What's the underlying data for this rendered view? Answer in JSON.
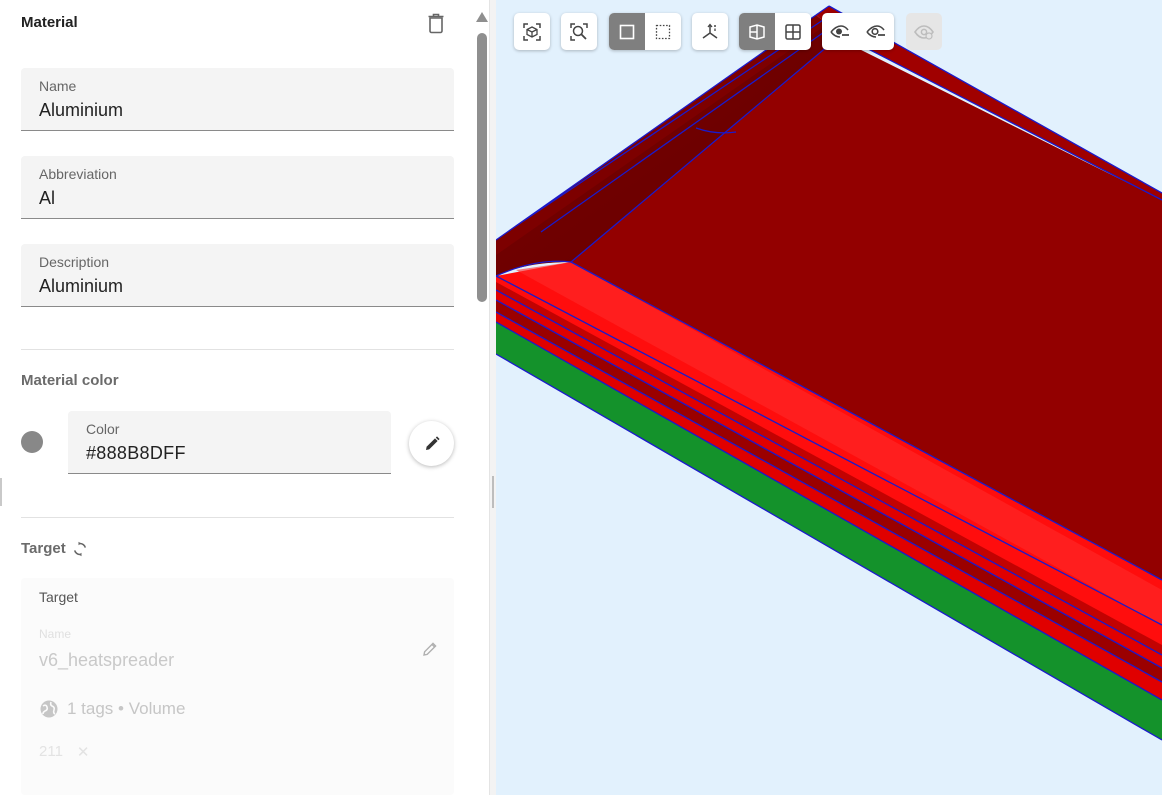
{
  "material": {
    "title": "Material",
    "name_label": "Name",
    "name_value": "Aluminium",
    "abbreviation_label": "Abbreviation",
    "abbreviation_value": "Al",
    "description_label": "Description",
    "description_value": "Aluminium"
  },
  "material_color": {
    "title": "Material color",
    "color_label": "Color",
    "color_value": "#888B8DFF",
    "swatch_color": "#888888"
  },
  "target": {
    "title": "Target",
    "card_label": "Target",
    "name_label": "Name",
    "name_value": "v6_heatspreader",
    "tags_text": "1 tags • Volume",
    "chip_value": "211",
    "chip_extra": "✕"
  },
  "toolbar": {
    "icons": [
      "fit-view-icon",
      "zoom-area-icon",
      "solid-select-icon",
      "box-select-icon",
      "axes-icon",
      "section-view-icon",
      "grid-view-icon",
      "hide-icon",
      "show-icon",
      "show-all-icon"
    ]
  },
  "scene_colors": {
    "top_face": "#930000",
    "bevel": "#ff0d0d",
    "green_layer": "#14922b",
    "edges": "#1a1acc",
    "background": "#e2f1fd"
  }
}
